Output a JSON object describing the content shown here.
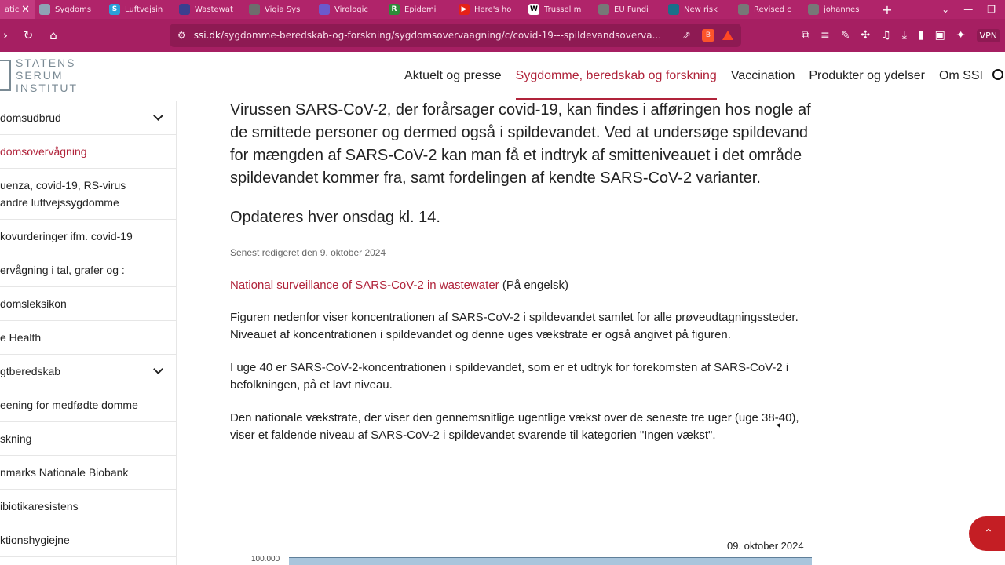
{
  "tabs": [
    {
      "title": "atic",
      "fav": "",
      "color": "#c33a80",
      "active": true
    },
    {
      "title": "Sygdoms",
      "fav": "",
      "color": "#8fa3b5"
    },
    {
      "title": "Luftvejsin",
      "fav": "S",
      "color": "#2a9fd8"
    },
    {
      "title": "Wastewat",
      "fav": "",
      "color": "#3b3f8f"
    },
    {
      "title": "Vigia Sys",
      "fav": "",
      "color": "#6d6d6d"
    },
    {
      "title": "Virologic",
      "fav": "",
      "color": "#6a5acd"
    },
    {
      "title": "Epidemi",
      "fav": "R",
      "color": "#2e8b3a"
    },
    {
      "title": "Here's ho",
      "fav": "▶",
      "color": "#e62117"
    },
    {
      "title": "Trussel m",
      "fav": "W",
      "color": "#ffffff"
    },
    {
      "title": "EU Fundi",
      "fav": "",
      "color": "#777777"
    },
    {
      "title": "New risk",
      "fav": "",
      "color": "#1b6f8a"
    },
    {
      "title": "Revised c",
      "fav": "",
      "color": "#777777"
    },
    {
      "title": "johannes",
      "fav": "",
      "color": "#777777"
    }
  ],
  "address": {
    "host": "ssi.dk",
    "path": "/sygdomme-beredskab-og-forskning/sygdomsovervaagning/c/covid-19---spildevandsoverva..."
  },
  "extensions": {
    "vpn": "VPN"
  },
  "site": {
    "logo_lines": [
      "STATENS",
      "SERUM",
      "INSTITUT"
    ],
    "nav": [
      "Aktuelt og presse",
      "Sygdomme, beredskab og forskning",
      "Vaccination",
      "Produkter og ydelser",
      "Om SSI"
    ]
  },
  "sidebar": [
    {
      "label": "domsudbrud",
      "chevron": true
    },
    {
      "label": "domsovervågning",
      "active": true
    },
    {
      "label": "uenza, covid-19, RS-virus andre luftvejssygdomme"
    },
    {
      "label": "kovurderinger ifm. covid-19"
    },
    {
      "label": "ervågning i tal, grafer og :"
    },
    {
      "label": "domsleksikon"
    },
    {
      "label": "e Health"
    },
    {
      "label": "gtberedskab",
      "chevron": true
    },
    {
      "label": "eening for medfødte domme"
    },
    {
      "label": "skning"
    },
    {
      "label": "nmarks Nationale Biobank"
    },
    {
      "label": "ibiotikaresistens"
    },
    {
      "label": "ktionshygiejne"
    }
  ],
  "content": {
    "lead": "Virussen SARS-CoV-2, der forårsager covid-19, kan findes i afføringen hos nogle af de smittede personer og dermed også i spildevandet. Ved at undersøge spildevand for mængden af SARS-CoV-2 kan man få et indtryk af smitteniveauet i det område spildevandet kommer fra, samt fordelingen af kendte SARS-CoV-2 varianter.",
    "updated": "Opdateres hver onsdag kl. 14.",
    "edited": "Senest redigeret den 9. oktober 2024",
    "link_text": "National surveillance of SARS-CoV-2 in wastewater",
    "link_suffix": " (På engelsk)",
    "para1": "Figuren nedenfor viser koncentrationen af SARS-CoV-2 i spildevandet samlet for alle prøveudtagningssteder. Niveauet af koncentrationen i spildevandet og denne uges vækstrate er også angivet på figuren.",
    "para2": "I uge 40 er SARS-CoV-2-koncentrationen i spildevandet, som er et udtryk for forekomsten af SARS-CoV-2 i befolkningen, på et lavt niveau.",
    "para3": "Den nationale vækstrate, der viser den gennemsnitlige ugentlige vækst over de seneste tre uger (uge 38-40), viser et faldende niveau af SARS-CoV-2 i spildevandet svarende til kategorien \"Ingen vækst\"."
  },
  "chart": {
    "date": "09. oktober 2024",
    "y_top_tick": "100.000"
  }
}
